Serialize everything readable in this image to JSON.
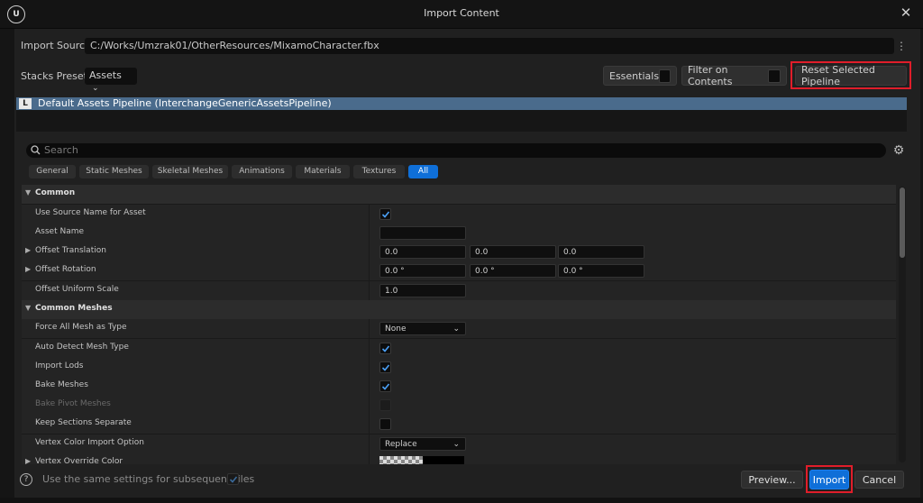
{
  "window": {
    "title": "Import Content"
  },
  "import_source": {
    "label": "Import Source",
    "path": "C:/Works/Umzrak01/OtherResources/MixamoCharacter.fbx"
  },
  "stacks_preset": {
    "label": "Stacks Preset",
    "value": "Assets"
  },
  "toolbar": {
    "essentials_label": "Essentials",
    "filter_label": "Filter on Contents",
    "reset_label": "Reset Selected Pipeline"
  },
  "pipeline": {
    "name": "Default Assets Pipeline (InterchangeGenericAssetsPipeline)"
  },
  "search": {
    "placeholder": "Search"
  },
  "tabs": [
    {
      "label": "General"
    },
    {
      "label": "Static Meshes"
    },
    {
      "label": "Skeletal Meshes"
    },
    {
      "label": "Animations"
    },
    {
      "label": "Materials"
    },
    {
      "label": "Textures"
    },
    {
      "label": "All"
    }
  ],
  "properties": {
    "common": "Common",
    "use_source_name": "Use Source Name for Asset",
    "asset_name": "Asset Name",
    "offset_translation": "Offset Translation",
    "offset_translation_values": [
      "0.0",
      "0.0",
      "0.0"
    ],
    "offset_rotation": "Offset Rotation",
    "offset_rotation_values": [
      "0.0 °",
      "0.0 °",
      "0.0 °"
    ],
    "offset_uniform_scale": "Offset Uniform Scale",
    "offset_uniform_scale_value": "1.0",
    "common_meshes": "Common Meshes",
    "force_all_mesh": "Force All Mesh as Type",
    "force_all_mesh_value": "None",
    "auto_detect": "Auto Detect Mesh Type",
    "import_lods": "Import Lods",
    "bake_meshes": "Bake Meshes",
    "bake_pivot": "Bake Pivot Meshes",
    "keep_sections": "Keep Sections Separate",
    "vertex_color_option": "Vertex Color Import Option",
    "vertex_color_option_value": "Replace",
    "vertex_override": "Vertex Override Color"
  },
  "footer": {
    "same_settings": "Use the same settings for subsequent files",
    "preview_label": "Preview...",
    "import_label": "Import",
    "cancel_label": "Cancel"
  },
  "colors": {
    "accent": "#0f6fd8",
    "highlight": "#e01d2a",
    "pipeline_row": "#4a6b8c"
  }
}
